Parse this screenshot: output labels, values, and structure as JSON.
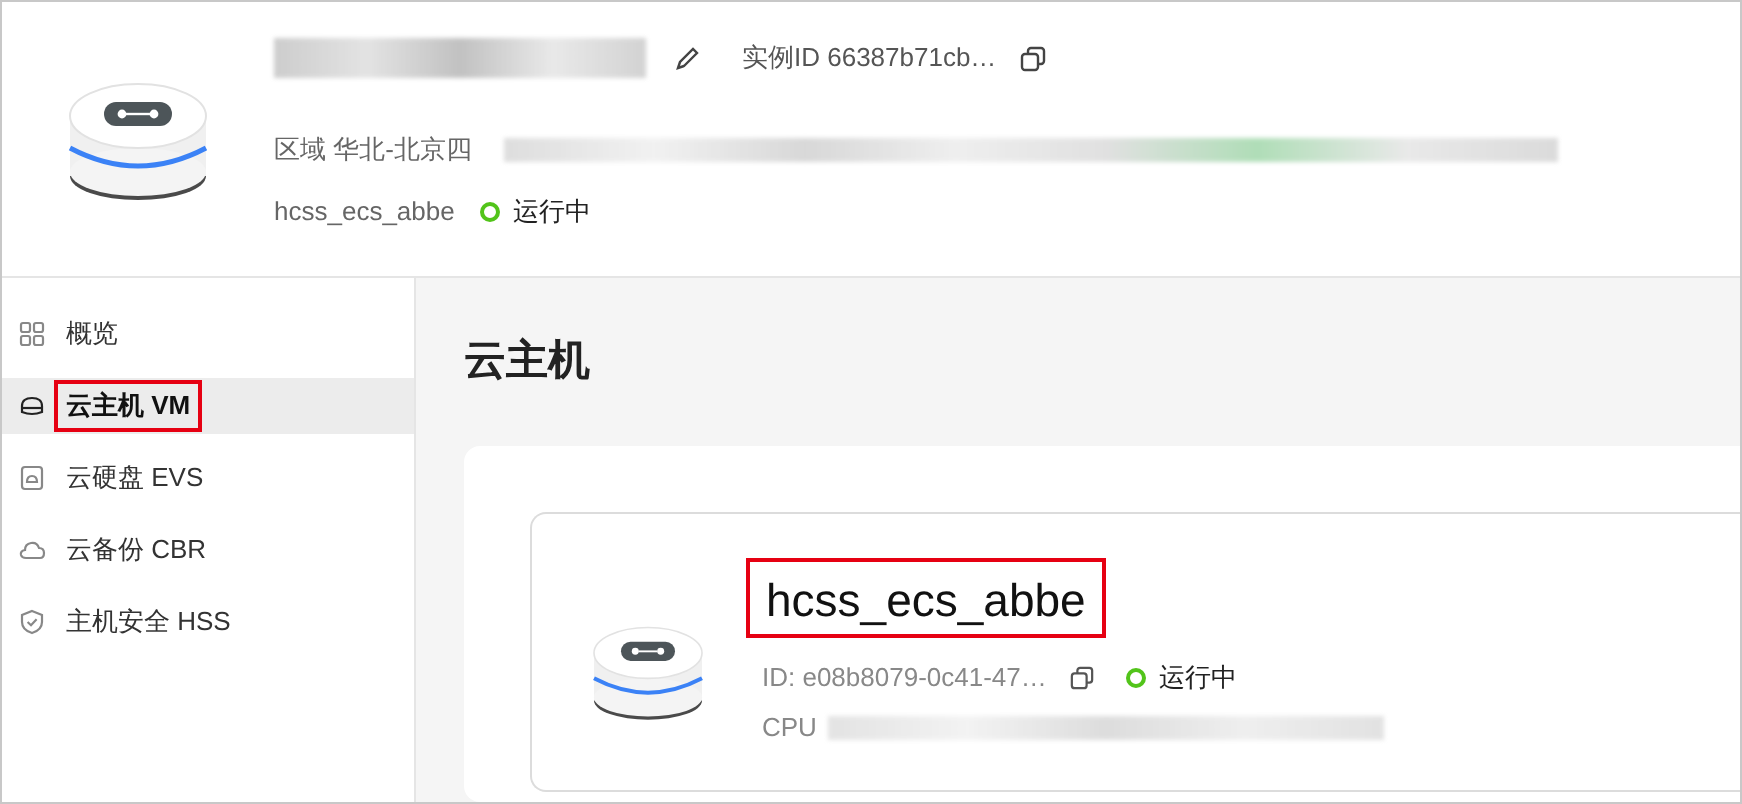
{
  "header": {
    "instance_id": "实例ID 66387b71cb…",
    "region": "区域 华北-北京四",
    "name": "hcss_ecs_abbe",
    "status": {
      "label": "运行中",
      "color": "#52c41a"
    }
  },
  "sidebar": {
    "items": [
      {
        "label": "概览",
        "kind": "grid",
        "selected": false,
        "highlighted": false
      },
      {
        "label": "云主机 VM",
        "kind": "vm",
        "selected": true,
        "highlighted": true
      },
      {
        "label": "云硬盘 EVS",
        "kind": "disk",
        "selected": false,
        "highlighted": false
      },
      {
        "label": "云备份 CBR",
        "kind": "cloud",
        "selected": false,
        "highlighted": false
      },
      {
        "label": "主机安全 HSS",
        "kind": "shield",
        "selected": false,
        "highlighted": false
      }
    ]
  },
  "page_title": "云主机",
  "card": {
    "title": "hcss_ecs_abbe",
    "highlighted": true,
    "id": "ID: e08b8079-0c41-47…",
    "status": {
      "label": "运行中",
      "color": "#52c41a"
    },
    "cpu_label": "CPU"
  }
}
